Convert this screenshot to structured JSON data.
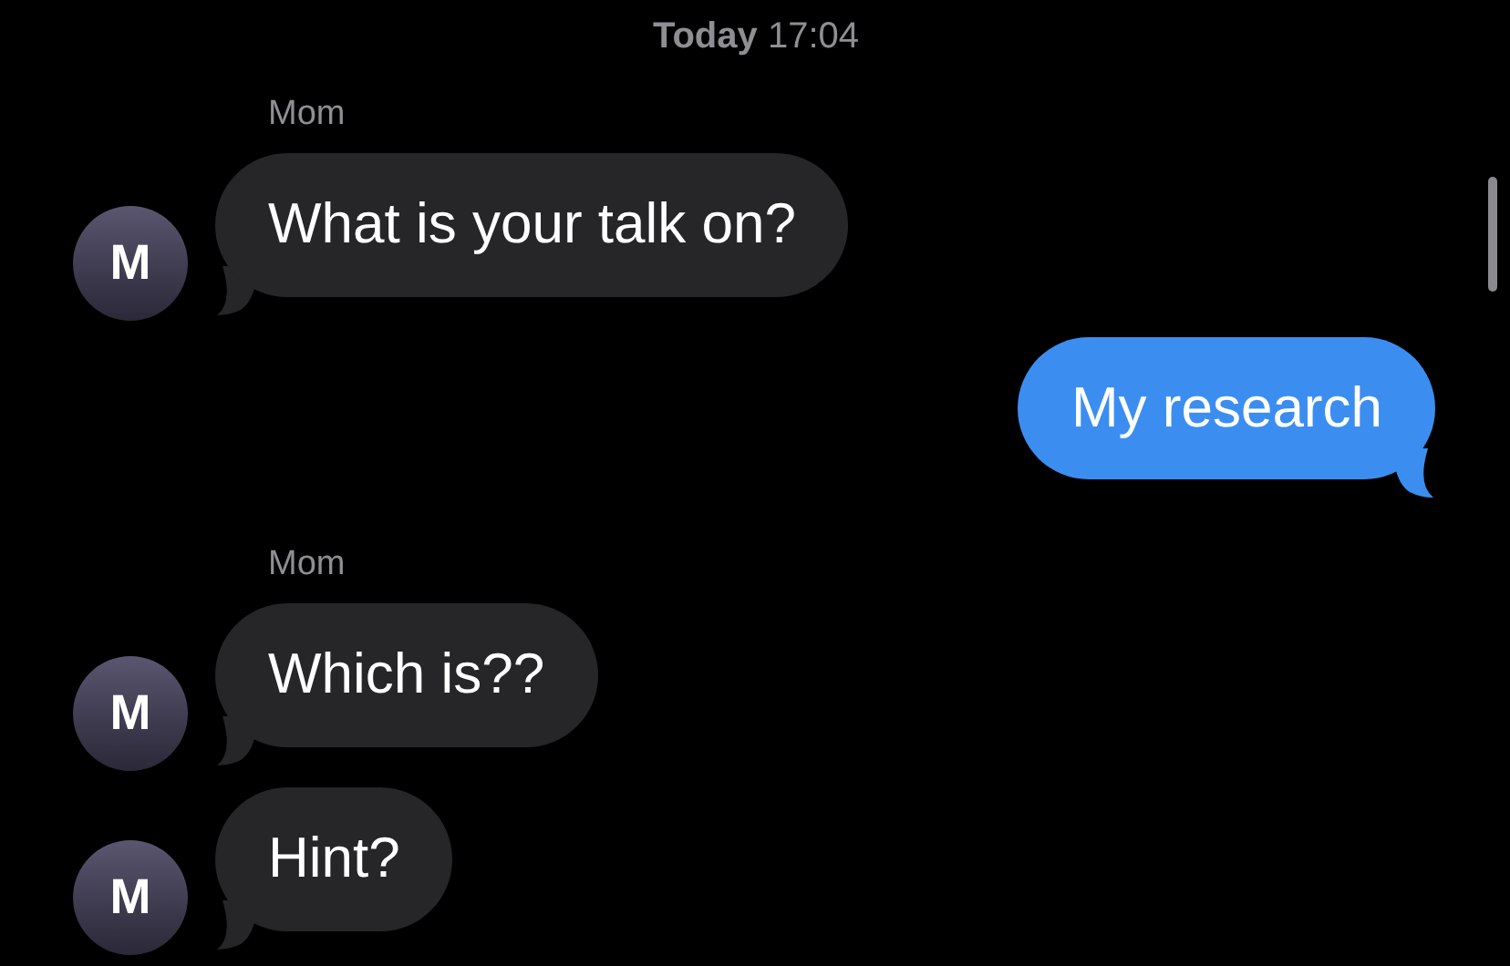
{
  "timestamp": {
    "day": "Today",
    "time": "17:04"
  },
  "messages": [
    {
      "kind": "label",
      "text": "Mom"
    },
    {
      "kind": "incoming",
      "text": "What is your talk on?",
      "avatar": "M"
    },
    {
      "kind": "outgoing",
      "text": "My research"
    },
    {
      "kind": "label",
      "text": "Mom"
    },
    {
      "kind": "incoming",
      "text": "Which is??",
      "avatar": "M"
    },
    {
      "kind": "incoming",
      "text": "Hint?",
      "avatar": "M"
    }
  ]
}
